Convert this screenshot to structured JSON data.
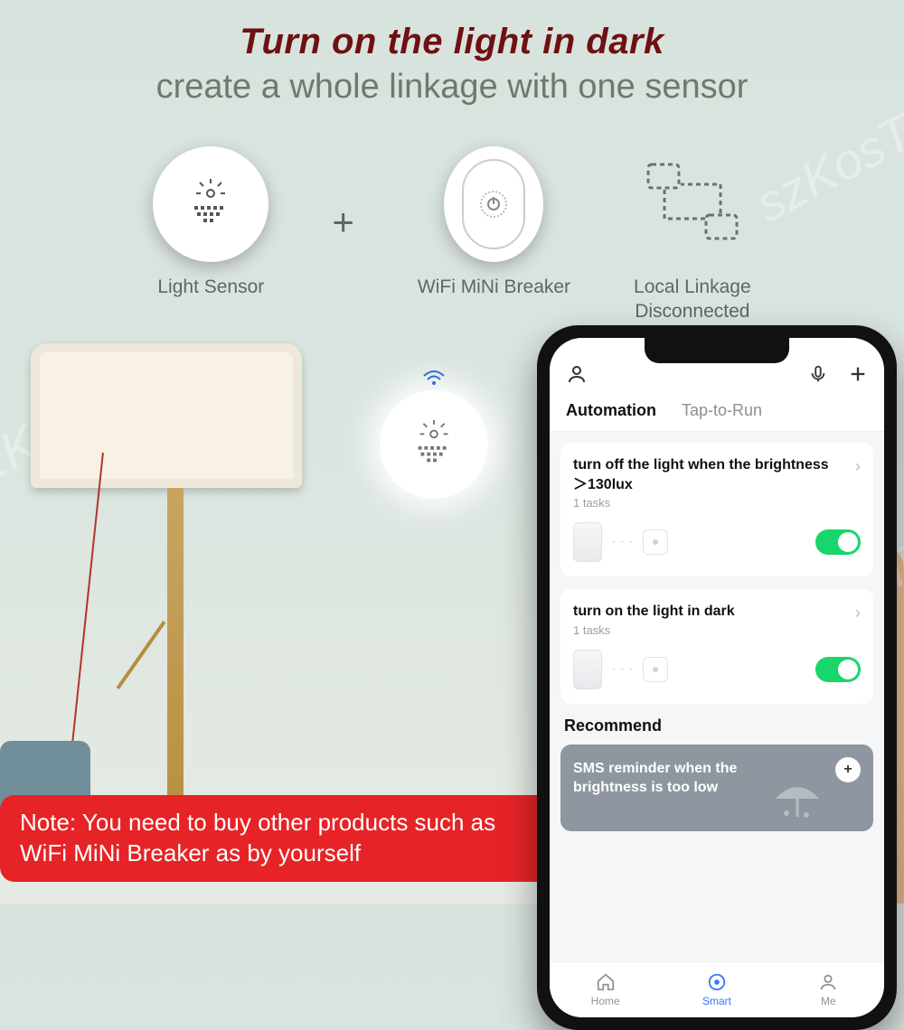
{
  "header": {
    "title": "Turn on the light in dark",
    "subtitle": "create a whole linkage with one sensor"
  },
  "devices": {
    "light_sensor": "Light Sensor",
    "breaker": "WiFi MiNi Breaker",
    "linkage": "Local Linkage\nDisconnected",
    "plus": "+"
  },
  "note": "Note: You need to buy other products such as WiFi MiNi Breaker as by yourself",
  "phone": {
    "tabs": {
      "automation": "Automation",
      "tap_to_run": "Tap-to-Run"
    },
    "cards": [
      {
        "title": "turn off the light when the brightness ＞130lux",
        "tasks": "1 tasks",
        "toggle_on": true
      },
      {
        "title": "turn on the light in dark",
        "tasks": "1 tasks",
        "toggle_on": true
      }
    ],
    "recommend_label": "Recommend",
    "recommend": {
      "title": "SMS reminder when the brightness is too low"
    },
    "nav": {
      "home": "Home",
      "smart": "Smart",
      "me": "Me"
    }
  },
  "watermark": "szKosTon"
}
